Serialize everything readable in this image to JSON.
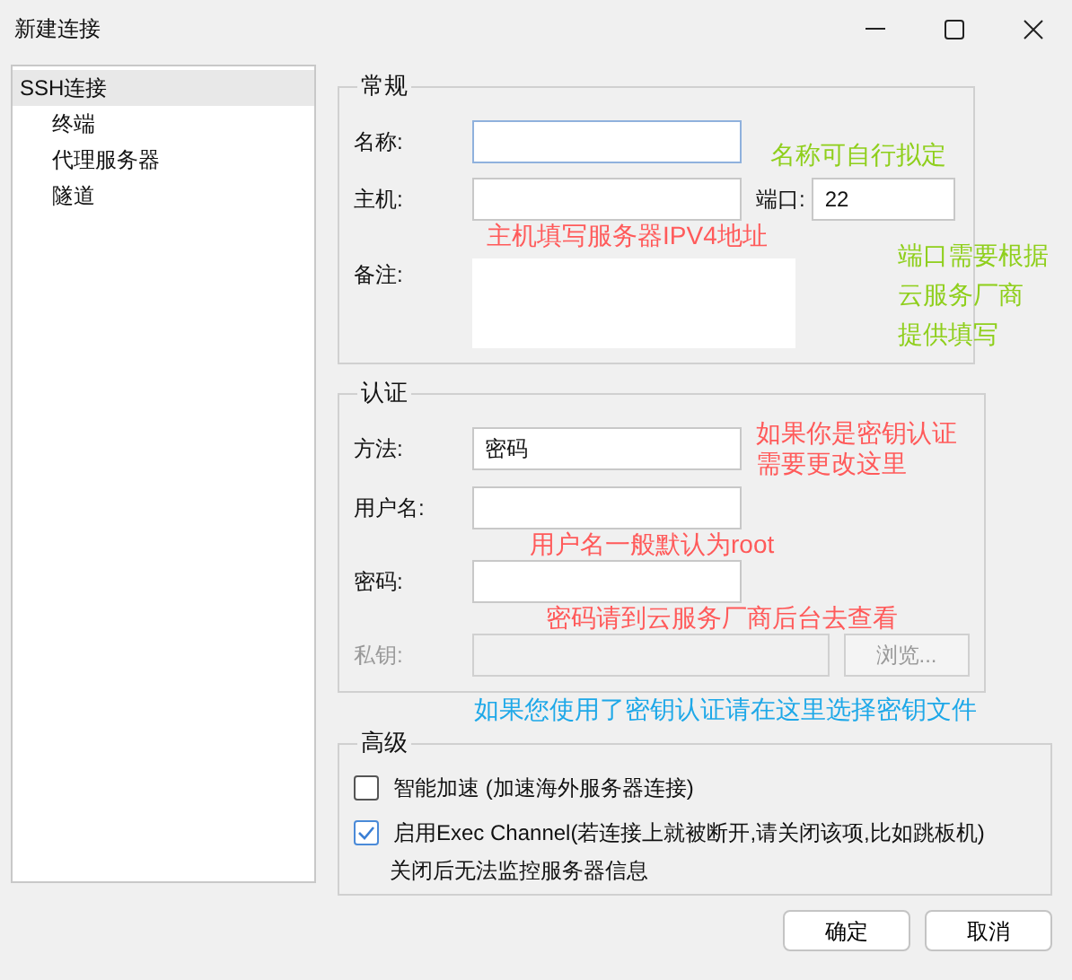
{
  "window": {
    "title": "新建连接"
  },
  "sidebar": {
    "items": [
      {
        "label": "SSH连接",
        "selected": true,
        "children": [
          {
            "label": "终端",
            "selected": false
          },
          {
            "label": "代理服务器",
            "selected": false
          },
          {
            "label": "隧道",
            "selected": false
          }
        ]
      }
    ]
  },
  "general": {
    "title": "常规",
    "name_label": "名称:",
    "host_label": "主机:",
    "port_label": "端口:",
    "port_value": "22",
    "note_label": "备注:"
  },
  "auth": {
    "title": "认证",
    "method_label": "方法:",
    "method_value": "密码",
    "user_label": "用户名:",
    "password_label": "密码:",
    "key_label": "私钥:",
    "key_disabled": true,
    "browse_button": "浏览...",
    "browse_disabled": true
  },
  "advanced": {
    "title": "高级",
    "options": [
      {
        "label": "智能加速 (加速海外服务器连接)",
        "checked": false
      },
      {
        "label": "启用Exec Channel(若连接上就被断开,请关闭该项,比如跳板机)",
        "checked": true
      }
    ],
    "note": "关闭后无法监控服务器信息"
  },
  "buttons": [
    "确定",
    "取消"
  ],
  "annotations": [
    {
      "text": "名称可自行拟定",
      "color": "#8fcf1c"
    },
    {
      "text": "主机填写服务器IPV4地址",
      "color": "#ff5a5a"
    },
    {
      "text": "端口需要根据",
      "color": "#8fcf1c"
    },
    {
      "text": "云服务厂商",
      "color": "#8fcf1c"
    },
    {
      "text": "提供填写",
      "color": "#8fcf1c"
    },
    {
      "text": "如果你是密钥认证",
      "color": "#ff5a5a"
    },
    {
      "text": "需要更改这里",
      "color": "#ff5a5a"
    },
    {
      "text": "用户名一般默认为root",
      "color": "#ff5a5a"
    },
    {
      "text": "密码请到云服务厂商后台去查看",
      "color": "#ff5a5a"
    },
    {
      "text": "如果您使用了密钥认证请在这里选择密钥文件",
      "color": "#1ea8e8"
    }
  ]
}
